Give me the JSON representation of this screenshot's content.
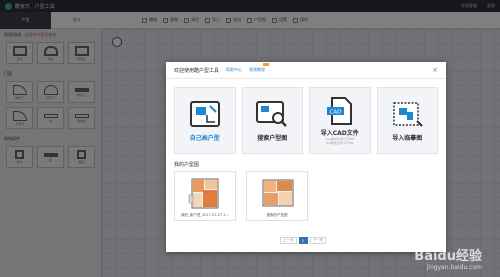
{
  "app": {
    "title": "酷家乐 · 户型工具",
    "top_links": [
      "在线客服",
      "登录"
    ]
  },
  "left_tabs": [
    "户型",
    "设计"
  ],
  "toolbar": [
    "撤销",
    "重做",
    "清空",
    "导入",
    "导出",
    "户型图",
    "设置",
    "保存"
  ],
  "left_panel": {
    "sections": [
      {
        "title": "画墙/画房",
        "hint": "在画布中双击结束"
      },
      {
        "title": "门窗"
      },
      {
        "title": "结构部件"
      }
    ],
    "tiles": [
      "直墙",
      "弧墙",
      "矩形房",
      "单开门",
      "双开门",
      "推拉门",
      "子母门",
      "窗",
      "落地窗",
      "柱子",
      "梁",
      "烟道"
    ]
  },
  "modal": {
    "title": "欢迎使用酷户型工具",
    "links": [
      "帮助中心",
      "视频教程"
    ],
    "cards": [
      {
        "label": "自己画户型",
        "primary": true
      },
      {
        "label": "搜索户型图",
        "primary": false
      },
      {
        "label": "导入CAD文件",
        "sub": "dwg格式文件小于8M\ndxf格式文件小于8M",
        "primary": false
      },
      {
        "label": "导入临摹图",
        "primary": false
      }
    ],
    "my_plans_title": "我的户型图",
    "plans": [
      {
        "name": "我的_新户型_2017-07-27 2..."
      },
      {
        "name": "搜索的户型图"
      }
    ],
    "pager": [
      "上一页",
      "1",
      "下一页"
    ]
  },
  "watermark": {
    "text": "Baidu经验",
    "url": "jingyan.baidu.com"
  },
  "colors": {
    "accent": "#1e88d6",
    "topbar": "#2d3039",
    "card_bg": "#f3f4f8"
  }
}
